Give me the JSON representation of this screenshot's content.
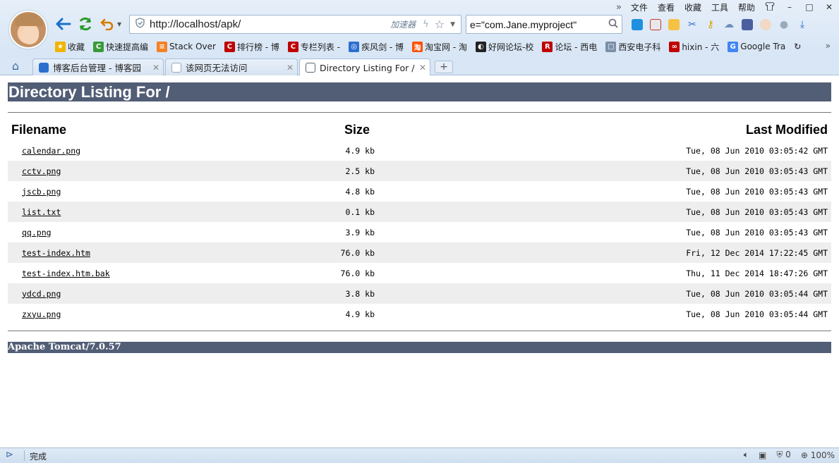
{
  "menu": {
    "more": "»",
    "items": [
      "文件",
      "查看",
      "收藏",
      "工具",
      "帮助"
    ],
    "skin_icon": "shirt-icon",
    "minimize": "–",
    "maximize": "□",
    "close": "✕"
  },
  "address": {
    "url": "http://localhost/apk/",
    "accelerator": "加速器"
  },
  "search": {
    "value": "e=\"com.Jane.myproject\""
  },
  "bookmarks": [
    {
      "label": "收藏",
      "color": "#f0b400",
      "glyph": "★"
    },
    {
      "label": "快速提高编",
      "color": "#3a9a3a",
      "glyph": "C"
    },
    {
      "label": "Stack Over",
      "color": "#f48024",
      "glyph": "≡"
    },
    {
      "label": "排行榜 - 博",
      "color": "#c00000",
      "glyph": "C"
    },
    {
      "label": "专栏列表 -",
      "color": "#c00000",
      "glyph": "C"
    },
    {
      "label": "疾风剑 - 博",
      "color": "#2b6ecf",
      "glyph": "◎"
    },
    {
      "label": "淘宝网 - 淘",
      "color": "#ff5000",
      "glyph": "淘"
    },
    {
      "label": "好网论坛-校",
      "color": "#222222",
      "glyph": "◐"
    },
    {
      "label": "论坛 - 西电",
      "color": "#c00000",
      "glyph": "R"
    },
    {
      "label": "西安电子科",
      "color": "#7a8fa8",
      "glyph": "▢"
    },
    {
      "label": "hixin - 六",
      "color": "#c00000",
      "glyph": "∞"
    },
    {
      "label": "Google Tra",
      "color": "#4285f4",
      "glyph": "G"
    }
  ],
  "bookmarks_more": "»",
  "tabs": [
    {
      "label": "博客后台管理 - 博客园",
      "color": "#2b6ecf"
    },
    {
      "label": "该网页无法访问",
      "color": "#9aa9bb"
    },
    {
      "label": "Directory Listing For /",
      "color": "#556677"
    }
  ],
  "tab_close": "✕",
  "tab_new": "+",
  "listing": {
    "title": "Directory Listing For /",
    "headers": {
      "filename": "Filename",
      "size": "Size",
      "modified": "Last Modified"
    },
    "rows": [
      {
        "name": "calendar.png",
        "size": "4.9 kb",
        "modified": "Tue, 08 Jun 2010 03:05:42 GMT"
      },
      {
        "name": "cctv.png",
        "size": "2.5 kb",
        "modified": "Tue, 08 Jun 2010 03:05:43 GMT"
      },
      {
        "name": "jscb.png",
        "size": "4.8 kb",
        "modified": "Tue, 08 Jun 2010 03:05:43 GMT"
      },
      {
        "name": "list.txt",
        "size": "0.1 kb",
        "modified": "Tue, 08 Jun 2010 03:05:43 GMT"
      },
      {
        "name": "qq.png",
        "size": "3.9 kb",
        "modified": "Tue, 08 Jun 2010 03:05:43 GMT"
      },
      {
        "name": "test-index.htm",
        "size": "76.0 kb",
        "modified": "Fri, 12 Dec 2014 17:22:45 GMT"
      },
      {
        "name": "test-index.htm.bak",
        "size": "76.0 kb",
        "modified": "Thu, 11 Dec 2014 18:47:26 GMT"
      },
      {
        "name": "ydcd.png",
        "size": "3.8 kb",
        "modified": "Tue, 08 Jun 2010 03:05:44 GMT"
      },
      {
        "name": "zxyu.png",
        "size": "4.9 kb",
        "modified": "Tue, 08 Jun 2010 03:05:44 GMT"
      }
    ],
    "footer": "Apache Tomcat/7.0.57"
  },
  "status": {
    "text": "完成",
    "security_count": "0",
    "zoom": "100%"
  },
  "colors": {
    "tomcat_header": "#525d76",
    "row_alt": "#eeeeee"
  }
}
